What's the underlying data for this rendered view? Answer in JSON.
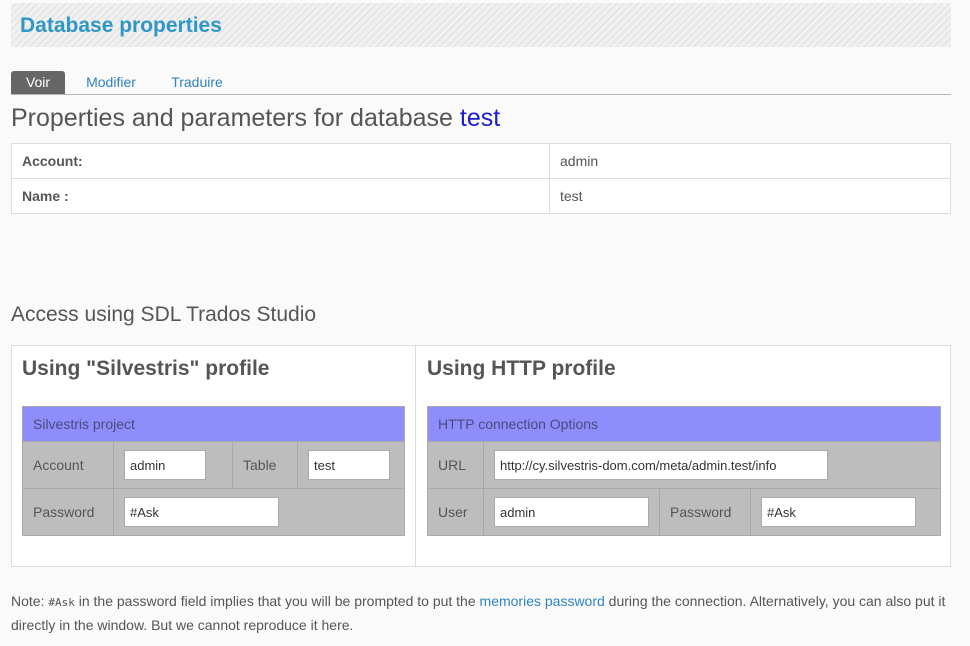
{
  "page": {
    "title": "Database properties"
  },
  "tabs": [
    {
      "label": "Voir",
      "active": true
    },
    {
      "label": "Modifier",
      "active": false
    },
    {
      "label": "Traduire",
      "active": false
    }
  ],
  "heading": {
    "prefix": "Properties and parameters for database ",
    "db_name": "test"
  },
  "properties": [
    {
      "key": "Account:",
      "value": "admin"
    },
    {
      "key": "Name :",
      "value": "test"
    }
  ],
  "access": {
    "title": "Access using SDL Trados Studio",
    "silvestris": {
      "title": "Using \"Silvestris\" profile",
      "header": "Silvestris project",
      "account_label": "Account",
      "account_value": "admin",
      "table_label": "Table",
      "table_value": "test",
      "password_label": "Password",
      "password_value": "#Ask"
    },
    "http": {
      "title": "Using HTTP profile",
      "header": "HTTP connection Options",
      "url_label": "URL",
      "url_value": "http://cy.silvestris-dom.com/meta/admin.test/info",
      "user_label": "User",
      "user_value": "admin",
      "password_label": "Password",
      "password_value": "#Ask"
    }
  },
  "note": {
    "prefix": "Note: ",
    "code": "#Ask",
    "middle": " in the password field implies that you will be prompted to put the ",
    "link": "memories password",
    "suffix": " during the connection. Alternatively, you can also put it directly in the window. But we cannot reproduce it here."
  },
  "colors": {
    "accent": "#2f97c7",
    "link": "#2f83c0",
    "table_header": "#8d8dfb",
    "db_name": "#1b1bcf"
  }
}
